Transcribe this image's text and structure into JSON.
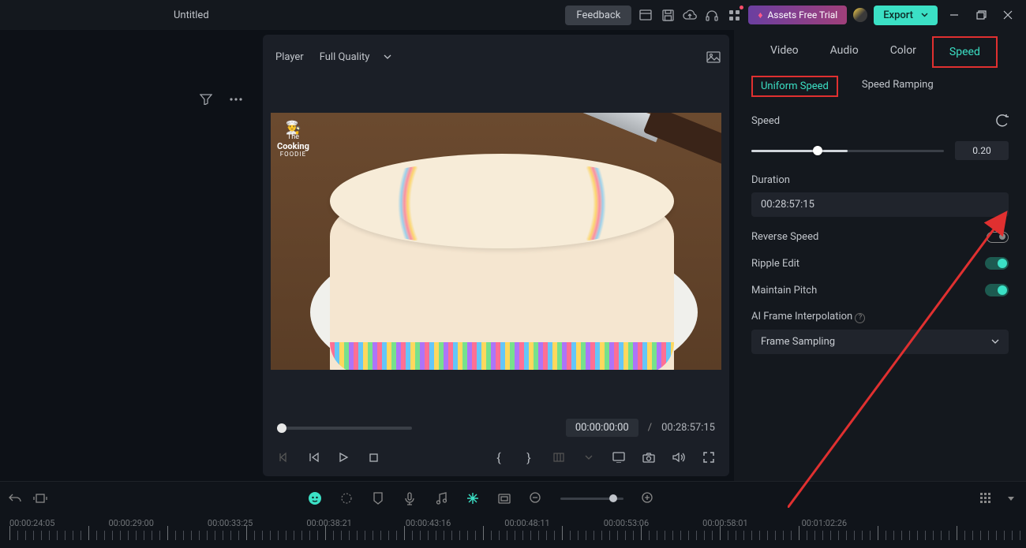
{
  "title": "Untitled",
  "topbar": {
    "feedback": "Feedback",
    "assets": "Assets Free Trial",
    "export": "Export"
  },
  "player": {
    "label": "Player",
    "quality": "Full Quality",
    "logo_line1": "The",
    "logo_line2": "Cooking",
    "logo_line3": "FOODIE",
    "current_time": "00:00:00:00",
    "total_time": "00:28:57:15"
  },
  "inspector": {
    "tabs": {
      "video": "Video",
      "audio": "Audio",
      "color": "Color",
      "speed": "Speed"
    },
    "subtabs": {
      "uniform": "Uniform Speed",
      "ramping": "Speed Ramping"
    },
    "speed_label": "Speed",
    "speed_value": "0.20",
    "duration_label": "Duration",
    "duration_value": "00:28:57:15",
    "reverse_speed": "Reverse Speed",
    "ripple_edit": "Ripple Edit",
    "maintain_pitch": "Maintain Pitch",
    "ai_frame": "AI Frame Interpolation",
    "ai_frame_value": "Frame Sampling"
  },
  "timeline": {
    "marks": [
      "00:00:24:05",
      "00:00:29:00",
      "00:00:33:25",
      "00:00:38:21",
      "00:00:43:16",
      "00:00:48:11",
      "00:00:53:06",
      "00:00:58:01",
      "00:01:02:26"
    ]
  }
}
